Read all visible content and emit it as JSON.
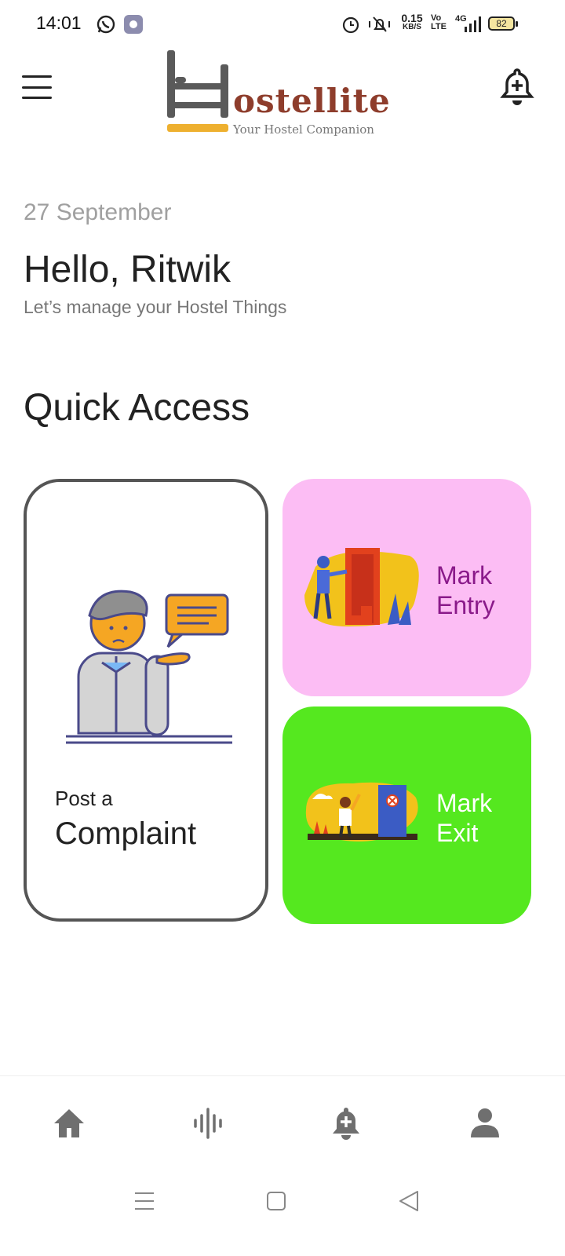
{
  "status_bar": {
    "time": "14:01",
    "net_speed_value": "0.15",
    "net_speed_unit": "KB/S",
    "volte_top": "Vo",
    "volte_bottom": "LTE",
    "network": "4G",
    "battery": "82"
  },
  "header": {
    "logo_word": "ostellite",
    "logo_tagline": "Your Hostel Companion"
  },
  "greeting": {
    "date": "27 September",
    "hello": "Hello, Ritwik",
    "subtitle": "Let’s manage your Hostel Things"
  },
  "quick_access": {
    "title": "Quick Access",
    "complaint": {
      "line1": "Post a",
      "line2": "Complaint"
    },
    "entry": {
      "line1": "Mark",
      "line2": "Entry"
    },
    "exit": {
      "line1": "Mark",
      "line2": "Exit"
    }
  },
  "colors": {
    "entry_card": "#fcbdf4",
    "exit_card": "#55e81f",
    "logo_brown": "#8e3d2c",
    "logo_yellow": "#eeb02f"
  },
  "bottom_nav": [
    "home-icon",
    "voice-wave-icon",
    "bell-add-icon",
    "person-icon"
  ],
  "system_nav": [
    "recents-icon",
    "home-square-icon",
    "back-triangle-icon"
  ]
}
